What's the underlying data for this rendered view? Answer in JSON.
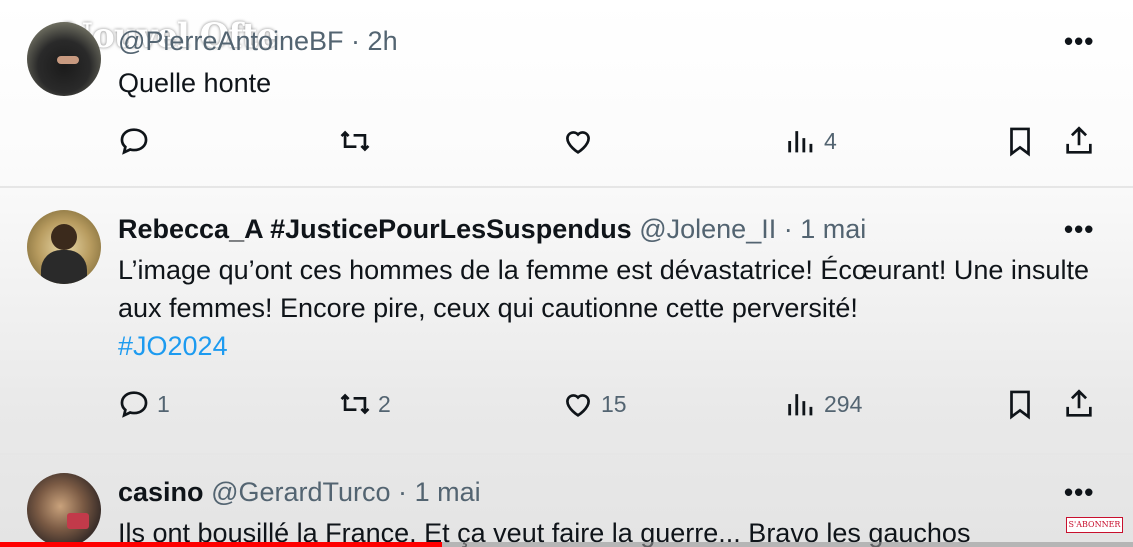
{
  "watermark": "Nouvel Ofte",
  "tweets": [
    {
      "name": "",
      "handle": "@PierreAntoineBF",
      "time": "2h",
      "text": "Quelle honte",
      "hashtag": "",
      "replies": "",
      "retweets": "",
      "likes": "",
      "views": "4"
    },
    {
      "name": "Rebecca_A #JusticePourLesSuspendus",
      "handle": "@Jolene_II",
      "time": "1 mai",
      "text": "L’image qu’ont ces hommes de la femme est dévastatrice! Écœurant! Une insulte aux femmes! Encore pire, ceux qui cautionne cette perversité!",
      "hashtag": "#JO2024",
      "replies": "1",
      "retweets": "2",
      "likes": "15",
      "views": "294"
    },
    {
      "name": "casino",
      "handle": "@GerardTurco",
      "time": "1 mai",
      "text": "Ils ont bousillé la France. Et ça veut faire la guerre... Bravo les gauchos",
      "hashtag": ""
    }
  ],
  "dot": "·",
  "more": "•••",
  "subscribe_badge": "S'ABONNER",
  "progress": 0.39,
  "colors": {
    "accent": "#1d9bf0",
    "progress": "#ff0000",
    "muted": "#536471"
  },
  "icons": [
    "reply-icon",
    "retweet-icon",
    "like-icon",
    "views-icon",
    "bookmark-icon",
    "share-icon",
    "more-icon"
  ]
}
